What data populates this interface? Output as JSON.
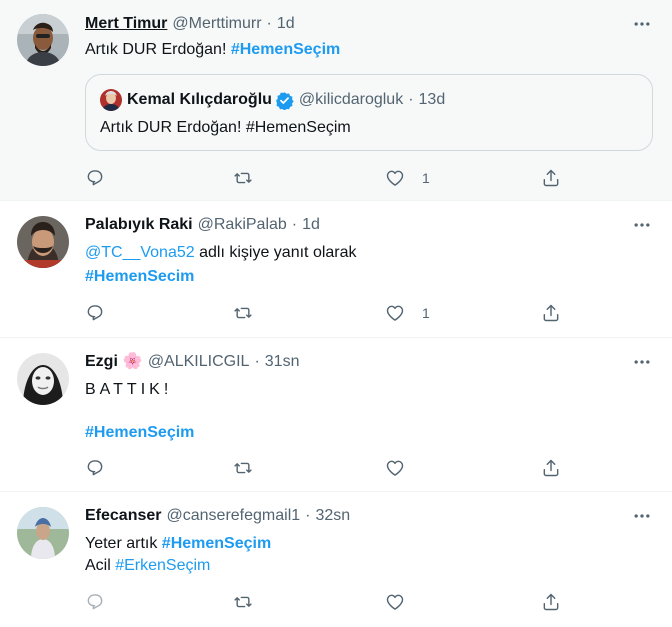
{
  "colors": {
    "accent": "#1d9bf0",
    "muted": "#536471",
    "text": "#0f1419",
    "highlight_bg": "#f7f9f9"
  },
  "tweets": [
    {
      "name": "Mert Timur",
      "handle": "@Merttimurr",
      "dot": "·",
      "time": "1d",
      "text": "Artık DUR Erdoğan!",
      "hashtag": "#HemenSeçim",
      "like_count": "1",
      "quote": {
        "name": "Kemal Kılıçdaroğlu",
        "verified_icon": "verified-badge-icon",
        "handle": "@kilicdarogluk",
        "dot": "·",
        "time": "13d",
        "text": "Artık DUR Erdoğan! #HemenSeçim"
      }
    },
    {
      "name": "Palabıyık Raki",
      "handle": "@RakiPalab",
      "dot": "·",
      "time": "1d",
      "reply_to": "@TC__Vona52",
      "reply_suffix": "adlı kişiye yanıt olarak",
      "hashtag": "#HemenSecim",
      "like_count": "1"
    },
    {
      "name": "Ezgi",
      "name_emoji": "🌸",
      "handle": "@ALKILICGIL",
      "dot": "·",
      "time": "31sn",
      "text": "BATTIK!",
      "hashtag": "#HemenSeçim"
    },
    {
      "name": "Efecanser",
      "handle": "@canserefegmail1",
      "dot": "·",
      "time": "32sn",
      "text_prefix": "Yeter artık",
      "hashtag": "#HemenSeçim",
      "line2_prefix": "Acil",
      "hashtag2": "#ErkenSeçim"
    }
  ],
  "icons": [
    "more-icon",
    "reply-icon",
    "retweet-icon",
    "like-icon",
    "share-icon"
  ]
}
